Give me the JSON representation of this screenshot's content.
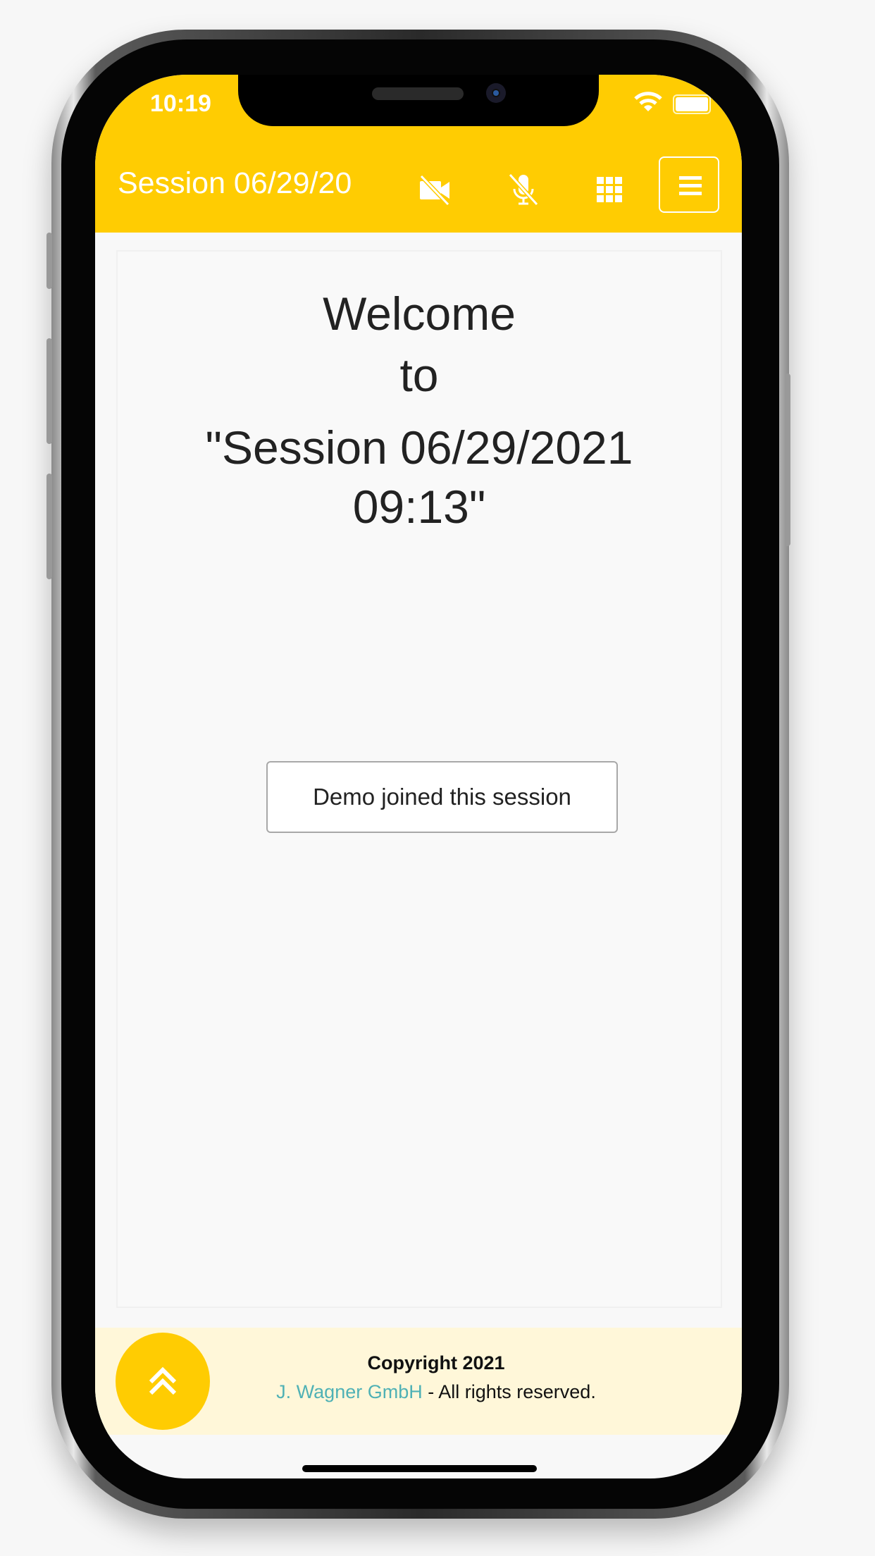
{
  "status_bar": {
    "time": "10:19",
    "wifi_icon": "wifi-icon",
    "battery_icon": "battery-icon"
  },
  "navbar": {
    "title": "Session 06/29/20",
    "icons": [
      "video-off-icon",
      "mic-off-icon",
      "grid-icon",
      "menu-icon"
    ],
    "color": "#ffcc02"
  },
  "main": {
    "welcome_line1": "Welcome",
    "welcome_line2": "to",
    "welcome_line3": "\"Session 06/29/2021",
    "welcome_line4": "09:13\"",
    "joined_message": "Demo joined this session"
  },
  "footer": {
    "copyright": "Copyright 2021",
    "company": "J. Wagner GmbH",
    "rights": " - All rights reserved.",
    "scroll_top_icon": "double-chevron-up-icon",
    "link_color": "#4fb1b5"
  }
}
